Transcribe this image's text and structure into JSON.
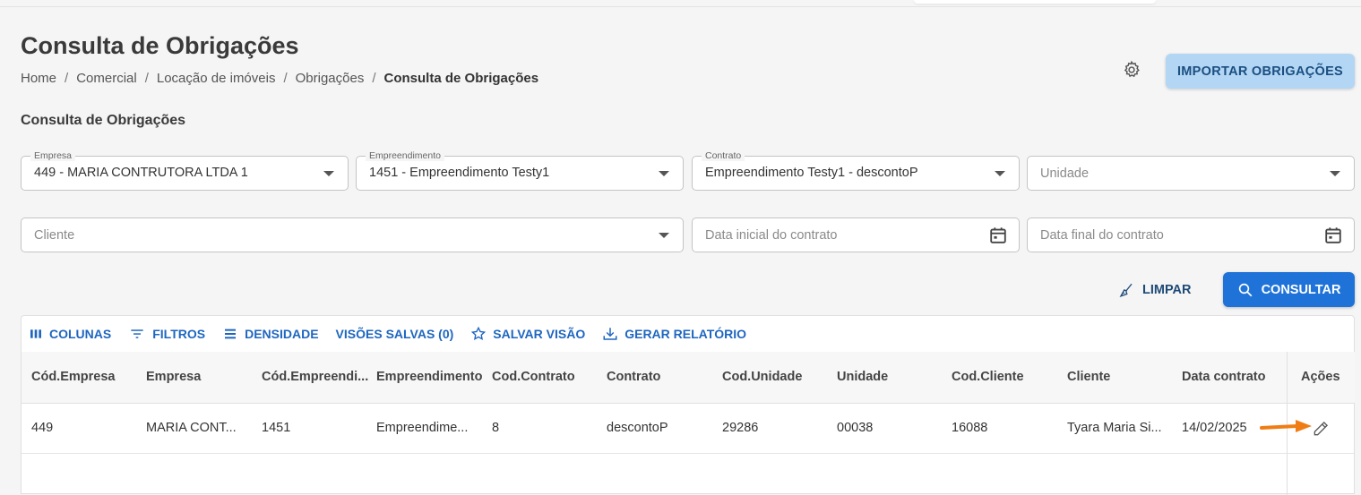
{
  "page": {
    "title": "Consulta de Obrigações",
    "breadcrumb": [
      "Home",
      "Comercial",
      "Locação de imóveis",
      "Obrigações",
      "Consulta de Obrigações"
    ],
    "import_button": "IMPORTAR OBRIGAÇÕES",
    "section_title": "Consulta de Obrigações"
  },
  "filters": {
    "empresa": {
      "label": "Empresa",
      "value": "449 - MARIA CONTRUTORA LTDA 1"
    },
    "empreendimento": {
      "label": "Empreendimento",
      "value": "1451 - Empreendimento Testy1"
    },
    "contrato": {
      "label": "Contrato",
      "value": "Empreendimento Testy1 - descontoP"
    },
    "unidade": {
      "placeholder": "Unidade"
    },
    "cliente": {
      "placeholder": "Cliente"
    },
    "data_inicial": {
      "placeholder": "Data inicial do contrato"
    },
    "data_final": {
      "placeholder": "Data final do contrato"
    }
  },
  "actions": {
    "limpar": "LIMPAR",
    "consultar": "CONSULTAR"
  },
  "toolbar": {
    "colunas": "COLUNAS",
    "filtros": "FILTROS",
    "densidade": "DENSIDADE",
    "visoes": "VISÕES SALVAS (0)",
    "salvar": "SALVAR VISÃO",
    "relatorio": "GERAR RELATÓRIO"
  },
  "table": {
    "columns": [
      "Cód.Empresa",
      "Empresa",
      "Cód.Empreendi...",
      "Empreendimento",
      "Cod.Contrato",
      "Contrato",
      "Cod.Unidade",
      "Unidade",
      "Cod.Cliente",
      "Cliente",
      "Data contrato",
      "Ações"
    ],
    "rows": [
      [
        "449",
        "MARIA CONT...",
        "1451",
        "Empreendime...",
        "8",
        "descontoP",
        "29286",
        "00038",
        "16088",
        "Tyara Maria Si...",
        "14/02/2025"
      ]
    ]
  },
  "colors": {
    "primary": "#1f73d8",
    "import_bg": "#b3d6f5",
    "toolbar_text": "#1e66c0",
    "annotation_arrow": "#f07d14"
  }
}
